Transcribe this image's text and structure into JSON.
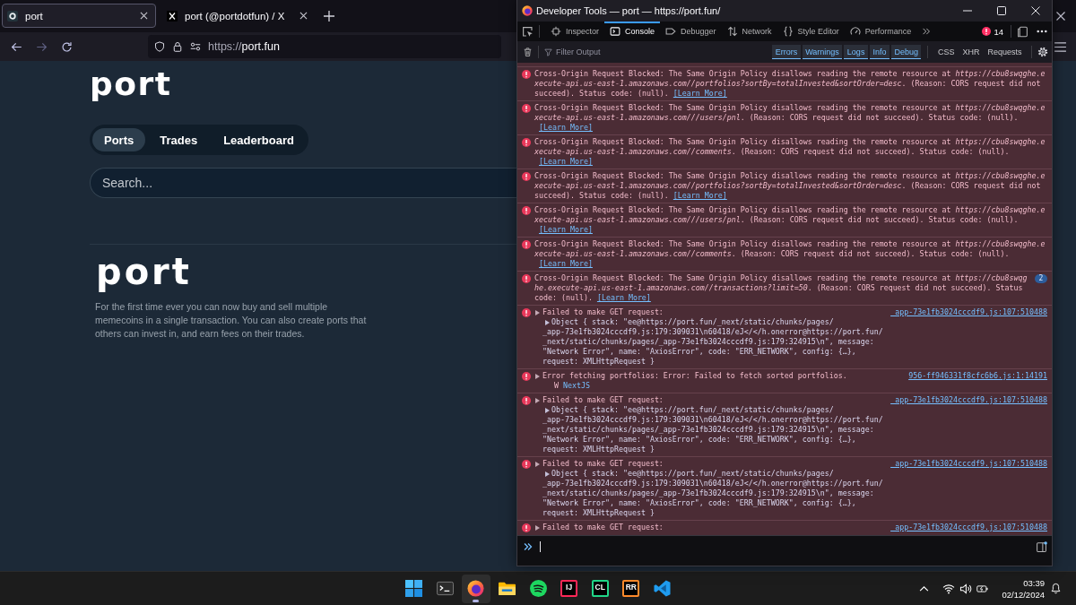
{
  "browser": {
    "tabs": [
      {
        "kind": "site",
        "title": "port",
        "selected": true
      },
      {
        "kind": "social",
        "title": "port (@portdotfun) / X",
        "selected": false
      }
    ],
    "nav": [
      {
        "kind": "back",
        "disabled": false
      },
      {
        "kind": "forward",
        "disabled": true
      },
      {
        "kind": "reload",
        "disabled": false
      }
    ],
    "address": {
      "scheme": "https://",
      "host": "port.fun"
    }
  },
  "page": {
    "logo": "port",
    "tabs": [
      {
        "label": "Ports",
        "selected": true
      },
      {
        "label": "Trades",
        "selected": false
      },
      {
        "label": "Leaderboard",
        "selected": false
      }
    ],
    "search": {
      "placeholder": "Search..."
    },
    "hero": {
      "logo": "port",
      "text": "For the first time ever you can now buy and sell multiple memecoins in a single transaction. You can also create ports that others can invest in, and earn fees on their trades."
    }
  },
  "devtools": {
    "title": "Developer Tools — port — https://port.fun/",
    "tools": [
      {
        "kind": "inspector",
        "label": "Inspector",
        "selected": false
      },
      {
        "kind": "console",
        "label": "Console",
        "selected": true
      },
      {
        "kind": "debugger",
        "label": "Debugger",
        "selected": false
      },
      {
        "kind": "network",
        "label": "Network",
        "selected": false
      },
      {
        "kind": "style",
        "label": "Style Editor",
        "selected": false
      },
      {
        "kind": "performance",
        "label": "Performance",
        "selected": false
      }
    ],
    "error_count": "14",
    "filter": {
      "placeholder": "Filter Output"
    },
    "levels": [
      {
        "label": "Errors",
        "on": true
      },
      {
        "label": "Warnings",
        "on": true
      },
      {
        "label": "Logs",
        "on": true
      },
      {
        "label": "Info",
        "on": true
      },
      {
        "label": "Debug",
        "on": true
      }
    ],
    "types": [
      {
        "label": "CSS",
        "on": false
      },
      {
        "label": "XHR",
        "on": false
      },
      {
        "label": "Requests",
        "on": false
      }
    ],
    "messages": [
      {
        "kind": "cors",
        "text": "Cross-Origin Request Blocked: The Same Origin Policy disallows reading the remote resource at *https://cbu8swqghe.execute-api.us-east-1.amazonaws.com//portfolios?sortBy=totalInvested&sortOrder=desc*. (Reason: CORS request did not succeed). Status code: (null).",
        "link": "[Learn More]"
      },
      {
        "kind": "cors",
        "text": "Cross-Origin Request Blocked: The Same Origin Policy disallows reading the remote resource at *https://cbu8swqghe.execute-api.us-east-1.amazonaws.com///users/pnl*. (Reason: CORS request did not succeed). Status code: (null).",
        "link": "[Learn More]"
      },
      {
        "kind": "cors",
        "text": "Cross-Origin Request Blocked: The Same Origin Policy disallows reading the remote resource at *https://cbu8swqghe.execute-api.us-east-1.amazonaws.com//comments*. (Reason: CORS request did not succeed). Status code: (null).",
        "link": "[Learn More]"
      },
      {
        "kind": "cors",
        "text": "Cross-Origin Request Blocked: The Same Origin Policy disallows reading the remote resource at *https://cbu8swqghe.execute-api.us-east-1.amazonaws.com//portfolios?sortBy=totalInvested&sortOrder=desc*. (Reason: CORS request did not succeed). Status code: (null).",
        "link": "[Learn More]"
      },
      {
        "kind": "cors",
        "text": "Cross-Origin Request Blocked: The Same Origin Policy disallows reading the remote resource at *https://cbu8swqghe.execute-api.us-east-1.amazonaws.com///users/pnl*. (Reason: CORS request did not succeed). Status code: (null).",
        "link": "[Learn More]"
      },
      {
        "kind": "cors",
        "text": "Cross-Origin Request Blocked: The Same Origin Policy disallows reading the remote resource at *https://cbu8swqghe.execute-api.us-east-1.amazonaws.com//comments*. (Reason: CORS request did not succeed). Status code: (null).",
        "link": "[Learn More]"
      },
      {
        "kind": "cors",
        "text": "Cross-Origin Request Blocked: The Same Origin Policy disallows reading the remote resource at *https://cbu8swqghe.execute-api.us-east-1.amazonaws.com//transactions?limit=50*. (Reason: CORS request did not succeed). Status code: (null).",
        "link": "[Learn More]",
        "repeat": "2"
      },
      {
        "kind": "log",
        "expanded": false,
        "text": "Failed to make GET request:",
        "source": "_app-73e1fb3024cccdf9.js:107:510488",
        "object": {
          "expanded": false,
          "lines": [
            "Object { stack: \"ee@https://port.fun/_next/static/chunks/pages/",
            "_app-73e1fb3024cccdf9.js:179:309031\\n60418/eJ</</h.onerror@https://port.fun/",
            "_next/static/chunks/pages/_app-73e1fb3024cccdf9.js:179:324915\\n\", message:",
            "\"Network Error\", name: \"AxiosError\", code: \"ERR_NETWORK\", config: {…},",
            "request: XMLHttpRequest }"
          ]
        }
      },
      {
        "kind": "log",
        "expanded": false,
        "text": "Error fetching portfolios: Error: Failed to fetch sorted portfolios.",
        "source": "956-ff946331f8cfc6b6.js:1:14191",
        "stack": [
          {
            "function": "W",
            "location": "NextJS"
          }
        ]
      },
      {
        "kind": "log",
        "expanded": false,
        "text": "Failed to make GET request:",
        "source": "_app-73e1fb3024cccdf9.js:107:510488",
        "object": {
          "expanded": false,
          "lines": [
            "Object { stack: \"ee@https://port.fun/_next/static/chunks/pages/",
            "_app-73e1fb3024cccdf9.js:179:309031\\n60418/eJ</</h.onerror@https://port.fun/",
            "_next/static/chunks/pages/_app-73e1fb3024cccdf9.js:179:324915\\n\", message:",
            "\"Network Error\", name: \"AxiosError\", code: \"ERR_NETWORK\", config: {…},",
            "request: XMLHttpRequest }"
          ]
        }
      },
      {
        "kind": "log",
        "expanded": false,
        "text": "Failed to make GET request:",
        "source": "_app-73e1fb3024cccdf9.js:107:510488",
        "object": {
          "expanded": false,
          "lines": [
            "Object { stack: \"ee@https://port.fun/_next/static/chunks/pages/",
            "_app-73e1fb3024cccdf9.js:179:309031\\n60418/eJ</</h.onerror@https://port.fun/",
            "_next/static/chunks/pages/_app-73e1fb3024cccdf9.js:179:324915\\n\", message:",
            "\"Network Error\", name: \"AxiosError\", code: \"ERR_NETWORK\", config: {…},",
            "request: XMLHttpRequest }"
          ]
        }
      },
      {
        "kind": "log",
        "expanded": false,
        "text": "Failed to make GET request:",
        "source": "_app-73e1fb3024cccdf9.js:107:510488"
      }
    ]
  },
  "taskbar": {
    "apps": [
      {
        "kind": "start",
        "selected": false
      },
      {
        "kind": "terminal",
        "selected": false
      },
      {
        "kind": "browser",
        "selected": true
      },
      {
        "kind": "files",
        "selected": false
      },
      {
        "kind": "music",
        "selected": false
      },
      {
        "kind": "ide",
        "label": "IJ",
        "color": "#fe2857",
        "selected": false
      },
      {
        "kind": "ide",
        "label": "CL",
        "color": "#21d789",
        "selected": false
      },
      {
        "kind": "ide",
        "label": "RR",
        "color": "#ff8a2b",
        "selected": false
      },
      {
        "kind": "editor",
        "selected": false
      }
    ],
    "clock": {
      "time": "03:39",
      "date": "02/12/2024"
    }
  }
}
